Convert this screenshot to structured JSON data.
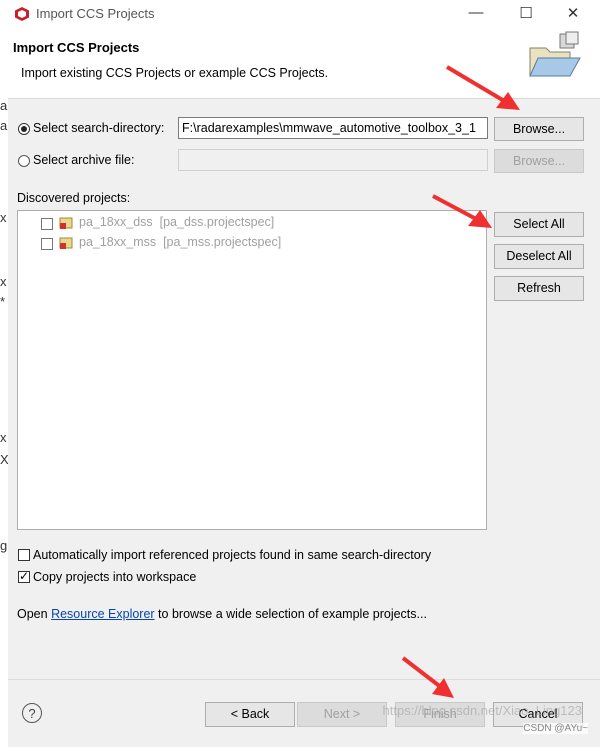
{
  "window": {
    "title": "Import CCS Projects",
    "controls": {
      "minimize": "—",
      "maximize": "☐",
      "close": "✕"
    }
  },
  "header": {
    "title": "Import CCS Projects",
    "description": "Import existing CCS Projects or example CCS Projects."
  },
  "source": {
    "search_dir_label": "Select search-directory:",
    "search_dir_value": "F:\\radarexamples\\mmwave_automotive_toolbox_3_1",
    "browse_label": "Browse...",
    "archive_label": "Select archive file:",
    "archive_value": "",
    "archive_browse_label": "Browse..."
  },
  "discovered": {
    "label": "Discovered projects:",
    "items": [
      {
        "name": "pa_18xx_dss",
        "spec": "[pa_dss.projectspec]"
      },
      {
        "name": "pa_18xx_mss",
        "spec": "[pa_mss.projectspec]"
      }
    ]
  },
  "side_buttons": {
    "select_all": "Select All",
    "deselect_all": "Deselect All",
    "refresh": "Refresh"
  },
  "options": {
    "auto_import": "Automatically import referenced projects found in same search-directory",
    "copy_projects": "Copy projects into workspace"
  },
  "resource": {
    "prefix": "Open ",
    "link": "Resource Explorer",
    "suffix": " to browse a wide selection of example projects..."
  },
  "footer": {
    "help": "?",
    "back": "< Back",
    "next": "Next >",
    "finish": "Finish",
    "cancel": "Cancel"
  },
  "left_fragments": [
    "a",
    "a",
    "x",
    "x",
    "*",
    "x",
    "X",
    "g"
  ],
  "watermark": "https://blog.csdn.net/Xiao_Ling123",
  "csdn_tag": "CSDN @AYu~",
  "colors": {
    "arrow": "#f03030",
    "link": "#0645ad",
    "accent_red": "#cc2222"
  }
}
